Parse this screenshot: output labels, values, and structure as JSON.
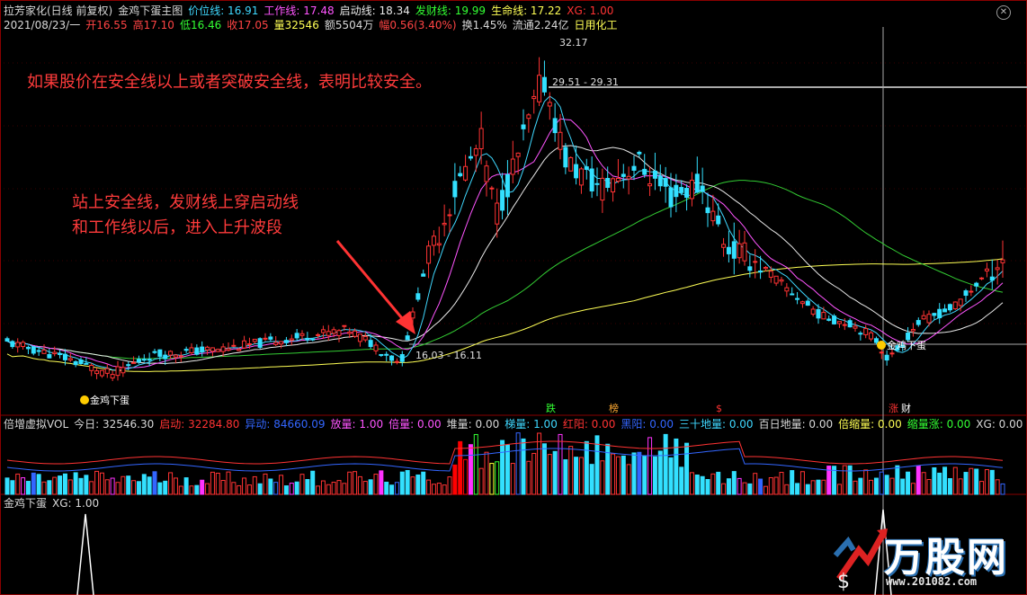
{
  "header1": [
    {
      "text": "拉芳家化(日线 前复权)",
      "color": "#d8d8d8"
    },
    {
      "text": "金鸡下蛋主图",
      "color": "#d8d8d8"
    },
    {
      "text": "价位线: 16.91",
      "color": "#3fd8ff"
    },
    {
      "text": "工作线: 17.48",
      "color": "#ff55ff"
    },
    {
      "text": "启动线: 18.34",
      "color": "#e8e8e8"
    },
    {
      "text": "发财线: 19.99",
      "color": "#33ff33"
    },
    {
      "text": "生命线: 17.22",
      "color": "#ffff55"
    },
    {
      "text": "XG: 1.00",
      "color": "#ff3333"
    }
  ],
  "header2": [
    {
      "text": "2021/08/23/一",
      "color": "#d8d8d8"
    },
    {
      "text": "开16.55",
      "color": "#ff4444"
    },
    {
      "text": "高17.10",
      "color": "#ff4444"
    },
    {
      "text": "低16.46",
      "color": "#33ff33"
    },
    {
      "text": "收17.05",
      "color": "#ff4444"
    },
    {
      "text": "量32546",
      "color": "#ffff55"
    },
    {
      "text": "额5504万",
      "color": "#d8d8d8"
    },
    {
      "text": "幅0.56(3.40%)",
      "color": "#ff4444"
    },
    {
      "text": "换1.45%",
      "color": "#d8d8d8"
    },
    {
      "text": "流通2.24亿",
      "color": "#d8d8d8"
    },
    {
      "text": "日用化工",
      "color": "#ffff55"
    }
  ],
  "vol_header": [
    {
      "text": "倍增虚拟VOL",
      "color": "#d8d8d8"
    },
    {
      "text": "今日: 32546.30",
      "color": "#d8d8d8"
    },
    {
      "text": "启动: 32284.80",
      "color": "#ff3333"
    },
    {
      "text": "异动: 84660.09",
      "color": "#3366ff"
    },
    {
      "text": "放量: 1.00",
      "color": "#ff55ff"
    },
    {
      "text": "倍量: 0.00",
      "color": "#ff55ff"
    },
    {
      "text": "堆量: 0.00",
      "color": "#d8d8d8"
    },
    {
      "text": "梯量: 1.00",
      "color": "#3fd8ff"
    },
    {
      "text": "红阳: 0.00",
      "color": "#ff3333"
    },
    {
      "text": "黑阳: 0.00",
      "color": "#3366ff"
    },
    {
      "text": "三十地量: 0.00",
      "color": "#3fd8ff"
    },
    {
      "text": "百日地量: 0.00",
      "color": "#d8d8d8"
    },
    {
      "text": "倍缩量: 0.00",
      "color": "#ffff55"
    },
    {
      "text": "缩量涨: 0.00",
      "color": "#33ff33"
    },
    {
      "text": "XG: 0.00",
      "color": "#d8d8d8"
    }
  ],
  "sig_header": [
    {
      "text": "金鸡下蛋",
      "color": "#d8d8d8"
    },
    {
      "text": "XG: 1.00",
      "color": "#d8d8d8"
    }
  ],
  "annotations": {
    "top": "如果股价在安全线以上或者突破安全线，表明比较安全。",
    "mid_line1": "站上安全线，发财线上穿启动线",
    "mid_line2": "和工作线以后，进入上升波段"
  },
  "logo": {
    "brand": "万股网",
    "url": "www.201082.com"
  },
  "chart_data": {
    "type": "candlestick",
    "price_range": [
      15.5,
      33.0
    ],
    "labels": {
      "high_price": "32.17",
      "mid_price": "29.51 - 29.31",
      "low_price": "16.03 - 16.11",
      "signal_left": "金鸡下蛋",
      "signal_right": "金鸡下蛋",
      "tag_1": "跌",
      "tag_2": "榜",
      "tag_3": "$",
      "tag_4": "涨",
      "tag_5": "财"
    },
    "colors": {
      "up": "#ff3333",
      "down": "#33e0ff",
      "ma_price": "#3fd8ff",
      "ma_work": "#ff55ff",
      "ma_start": "#e8e8e8",
      "ma_cai": "#33cc33",
      "ma_life": "#ffff55"
    }
  }
}
